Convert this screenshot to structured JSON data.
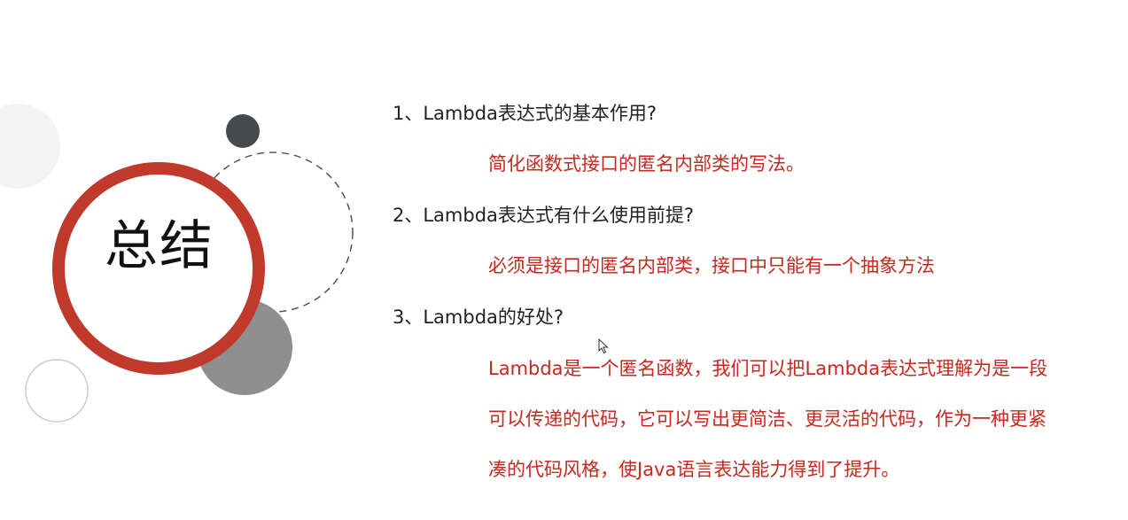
{
  "title": "总结",
  "items": [
    {
      "question": "1、Lambda表达式的基本作用?",
      "answer_lines": [
        "简化函数式接口的匿名内部类的写法。"
      ]
    },
    {
      "question": "2、Lambda表达式有什么使用前提?",
      "answer_lines": [
        "必须是接口的匿名内部类，接口中只能有一个抽象方法"
      ]
    },
    {
      "question": "3、Lambda的好处?",
      "answer_lines": [
        "Lambda是一个匿名函数，我们可以把Lambda表达式理解为是一段",
        "可以传递的代码，它可以写出更简洁、更灵活的代码，作为一种更紧",
        "凑的代码风格，使Java语言表达能力得到了提升。"
      ]
    }
  ],
  "colors": {
    "accent": "#c0392b",
    "answer_text": "#c8281e",
    "question_text": "#222222",
    "dark_circle": "#454a4d",
    "gray_circle": "#8f8f8f",
    "light_circle": "#f3f3f3"
  }
}
